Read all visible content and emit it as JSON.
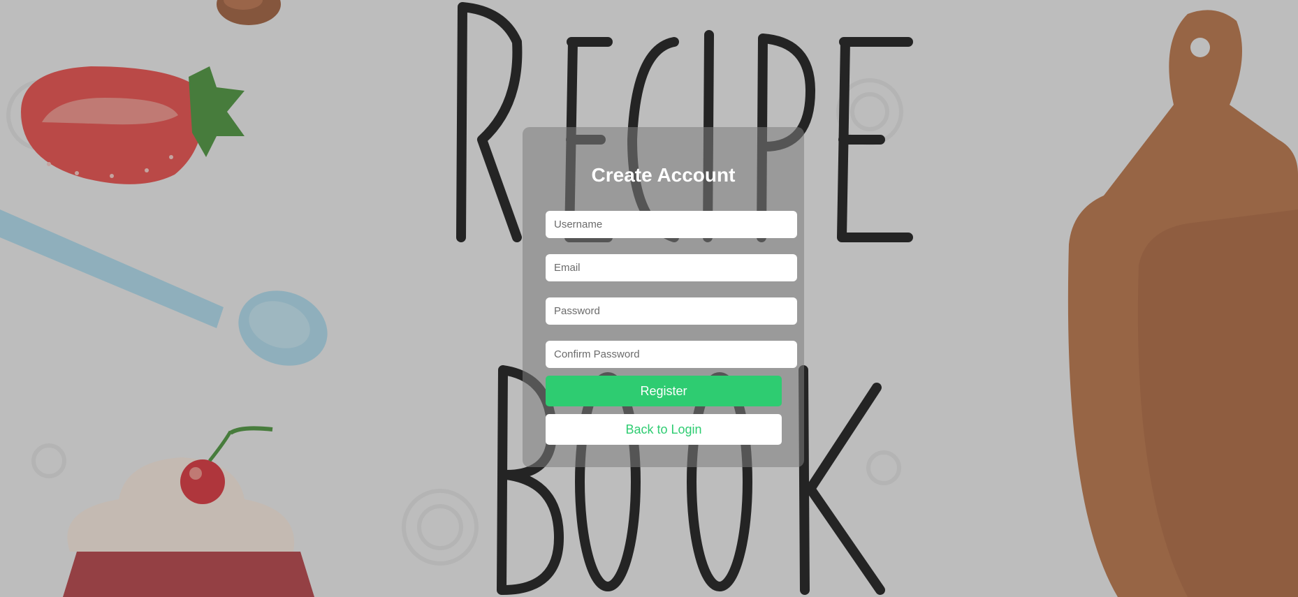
{
  "form": {
    "title": "Create Account",
    "fields": {
      "username_placeholder": "Username",
      "email_placeholder": "Email",
      "password_placeholder": "Password",
      "confirm_password_placeholder": "Confirm Password"
    },
    "register_label": "Register",
    "back_label": "Back to Login"
  },
  "colors": {
    "accent": "#2ecc71",
    "button_text": "#ffffff",
    "card_overlay": "rgba(125,125,125,0.55)"
  },
  "background": {
    "illustrations": [
      "strawberry-icon",
      "spoon-icon",
      "cupcake-icon",
      "cutting-board-icon",
      "chocolate-ball-icon"
    ],
    "lettering": "RECIPE BOOK"
  }
}
